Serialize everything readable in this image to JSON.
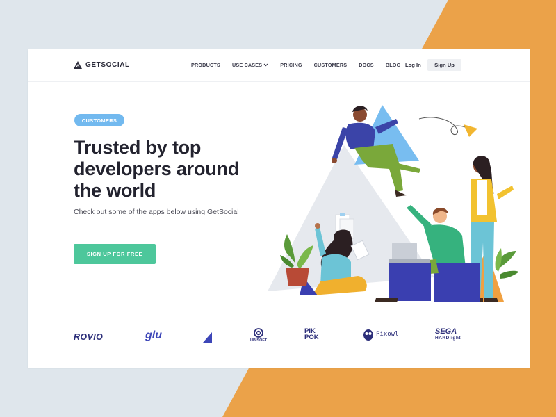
{
  "brand": {
    "name": "GETSOCIAL"
  },
  "nav": {
    "links": [
      "PRODUCTS",
      "USE CASES",
      "PRICING",
      "CUSTOMERS",
      "DOCS",
      "BLOG"
    ],
    "login": "Log In",
    "signup": "Sign Up"
  },
  "hero": {
    "badge": "CUSTOMERS",
    "headline_1": "Trusted by top",
    "headline_2": "developers around",
    "headline_3": "the world",
    "subtext": "Check out some of the apps below using GetSocial",
    "cta": "SIGN UP FOR FREE"
  },
  "customer_logos": {
    "rovio": "ROVIO",
    "glu": "glu",
    "ubisoft": "UBISOFT",
    "pikpok_1": "PIK",
    "pikpok_2": "POK",
    "pixowl": "Pixowl",
    "sega_1": "SEGA",
    "sega_2": "HARDlight"
  },
  "colors": {
    "accent_green": "#4dc79b",
    "badge_blue": "#72b9ef",
    "background_orange": "#eba249",
    "logo_navy": "#2d2f7a"
  }
}
